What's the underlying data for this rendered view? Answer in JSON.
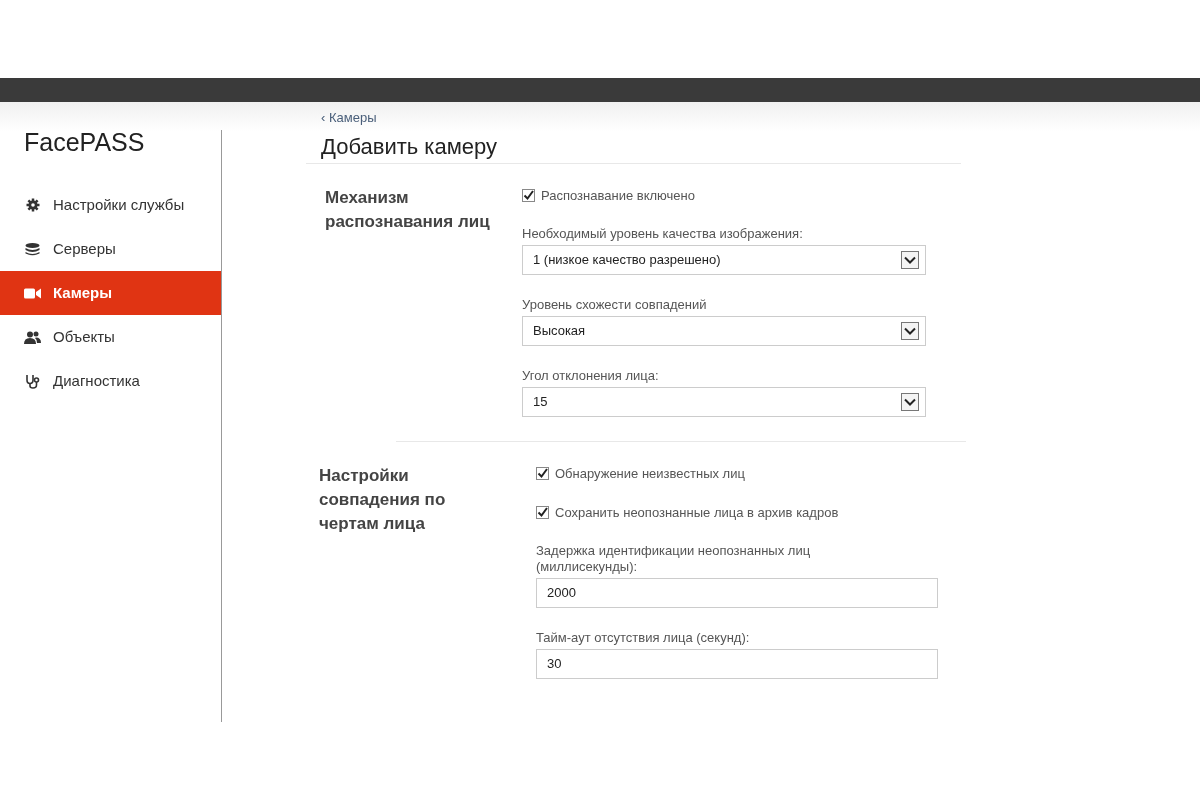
{
  "app": {
    "logo": "FacePASS"
  },
  "sidebar": {
    "items": [
      {
        "label": "Настройки службы",
        "selected": false
      },
      {
        "label": "Серверы",
        "selected": false
      },
      {
        "label": "Камеры",
        "selected": true
      },
      {
        "label": "Объекты",
        "selected": false
      },
      {
        "label": "Диагностика",
        "selected": false
      }
    ]
  },
  "breadcrumb": "‹ Камеры",
  "title": "Добавить камеру",
  "sections": [
    {
      "heading": "Механизм распознавания лиц",
      "fields": [
        {
          "kind": "checkbox",
          "label": "Распознавание включено",
          "checked": true
        },
        {
          "kind": "select",
          "label": "Необходимый уровень качества изображения:",
          "value": "1 (низкое качество разрешено)"
        },
        {
          "kind": "select",
          "label": "Уровень схожести совпадений",
          "value": "Высокая"
        },
        {
          "kind": "select",
          "label": "Угол отклонения лица:",
          "value": "15"
        }
      ]
    },
    {
      "heading": "Настройки совпадения по чертам лица",
      "fields": [
        {
          "kind": "checkbox",
          "label": "Обнаружение неизвестных лиц",
          "checked": true
        },
        {
          "kind": "checkbox",
          "label": "Сохранить неопознанные лица в архив кадров",
          "checked": true
        },
        {
          "kind": "text",
          "label": "Задержка идентификации неопознанных лиц (миллисекунды):",
          "value": "2000"
        },
        {
          "kind": "text",
          "label": "Тайм-аут отсутствия лица (секунд):",
          "value": "30"
        }
      ]
    }
  ]
}
